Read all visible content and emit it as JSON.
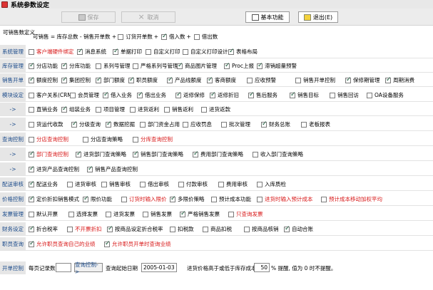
{
  "window": {
    "title": "系统参数设定"
  },
  "toolbar": {
    "save": "保存",
    "cancel": "取消",
    "basic": "基本功能",
    "exit": "退出(E)"
  },
  "avail_label": "可销售数定义",
  "formula": {
    "prefix": "可销售 = 库存总数 - 销售开单数 +",
    "items": [
      {
        "label": "订货开单数",
        "checked": false,
        "sign": "+"
      },
      {
        "label": "借入数",
        "checked": true,
        "sign": "+"
      },
      {
        "label": "借出数",
        "checked": false,
        "sign": ""
      }
    ]
  },
  "rows": [
    {
      "label": "系统管理",
      "items": [
        {
          "t": "客户端硬件绑定",
          "c": false,
          "r": true
        },
        {
          "t": "消息系统",
          "c": true
        },
        {
          "t": "单据打印",
          "c": true
        },
        {
          "t": "自定义打印",
          "c": false
        },
        {
          "t": "自定义打印设计",
          "c": false
        },
        {
          "t": "表格布局",
          "c": true
        }
      ]
    },
    {
      "label": "库存管理",
      "items": [
        {
          "t": "分店功能",
          "c": true
        },
        {
          "t": "分库功能",
          "c": true
        },
        {
          "t": "系列号管理",
          "c": false
        },
        {
          "t": "严格系列号管理",
          "c": false
        },
        {
          "t": "商品图片管理",
          "c": true
        },
        {
          "t": "Proc上报",
          "c": true
        },
        {
          "t": "滞销超量预警",
          "c": true
        }
      ]
    },
    {
      "label": "销售开单",
      "items": [
        {
          "t": "额度控制",
          "c": true
        },
        {
          "t": "集团控制",
          "c": true
        },
        {
          "t": "部门额度",
          "c": true
        },
        {
          "t": "职员额度",
          "c": true
        },
        {
          "t": "产品线额度",
          "c": true
        },
        {
          "t": "客商额度",
          "c": true
        },
        {
          "t": "应收预警",
          "c": false
        },
        {
          "t": "销售开单控制",
          "c": false
        },
        {
          "t": "保修期管理",
          "c": true
        },
        {
          "t": "周期消费",
          "c": true
        }
      ]
    },
    {
      "label": "模块设定",
      "items": [
        {
          "t": "客户关系(CRM)",
          "c": false
        },
        {
          "t": "会员管理",
          "c": false
        },
        {
          "t": "借入业务",
          "c": true
        },
        {
          "t": "借出业务",
          "c": true
        },
        {
          "t": "返修保修",
          "c": true
        },
        {
          "t": "返修折旧",
          "c": true
        },
        {
          "t": "售后服务",
          "c": true
        },
        {
          "t": "销售目标",
          "c": true
        },
        {
          "t": "销售回访",
          "c": false
        },
        {
          "t": "OA设备服务",
          "c": false
        }
      ]
    },
    {
      "label": "->",
      "items": [
        {
          "t": "直销业务",
          "c": false
        },
        {
          "t": "组装业务",
          "c": true
        },
        {
          "t": "项目管理",
          "c": false
        },
        {
          "t": "进货返利",
          "c": false
        },
        {
          "t": "销售返利",
          "c": false
        },
        {
          "t": "进货返款",
          "c": false
        }
      ]
    },
    {
      "label": "->",
      "items": [
        {
          "t": "货运代收款",
          "c": false
        },
        {
          "t": "分级查询",
          "c": true
        },
        {
          "t": "数据挖掘",
          "c": true
        },
        {
          "t": "部门资金占用",
          "c": false
        },
        {
          "t": "应收罚息",
          "c": false
        },
        {
          "t": "批次管理",
          "c": false
        },
        {
          "t": "财务总账",
          "c": true
        },
        {
          "t": "老板报表",
          "c": false
        }
      ]
    },
    {
      "label": "查询控制",
      "items": [
        {
          "t": "分店查询控制",
          "c": false,
          "r": true
        },
        {
          "t": "分店查询策略",
          "c": false
        },
        {
          "t": "分库查询控制",
          "c": false,
          "r": true
        }
      ]
    },
    {
      "label": "->",
      "items": [
        {
          "t": "部门查询控制",
          "c": true,
          "r": true
        },
        {
          "t": "进货部门查询策略",
          "c": true
        },
        {
          "t": "销售部门查询策略",
          "c": true
        },
        {
          "t": "费用部门查询策略",
          "c": true
        },
        {
          "t": "收入部门查询策略",
          "c": false
        }
      ]
    },
    {
      "label": "->",
      "items": [
        {
          "t": "进货产品查询控制",
          "c": true
        },
        {
          "t": "销售产品查询控制",
          "c": true
        }
      ]
    },
    {
      "label": "配送审核",
      "items": [
        {
          "t": "配送业务",
          "c": true
        },
        {
          "t": "进货审核",
          "c": false
        },
        {
          "t": "销售审核",
          "c": false
        },
        {
          "t": "借出审核",
          "c": false
        },
        {
          "t": "付款审核",
          "c": false
        },
        {
          "t": "费用审核",
          "c": false
        },
        {
          "t": "入库质检",
          "c": false
        }
      ]
    },
    {
      "label": "价格控制",
      "items": [
        {
          "t": "定价折扣销售模式",
          "c": true
        },
        {
          "t": "限价功能",
          "c": true
        },
        {
          "t": "订货时输入限价",
          "c": false,
          "r": true
        },
        {
          "t": "多限价策略",
          "c": true
        },
        {
          "t": "预计成本功能",
          "c": false
        },
        {
          "t": "进货时输入预计成本",
          "c": false,
          "r": true
        },
        {
          "t": "预计成本移动加权平均",
          "c": false,
          "r": true
        }
      ]
    },
    {
      "label": "发票管理",
      "items": [
        {
          "t": "默认开票",
          "c": false
        },
        {
          "t": "选择发票",
          "c": false
        },
        {
          "t": "进货发票",
          "c": false
        },
        {
          "t": "销售发票",
          "c": false
        },
        {
          "t": "严格销售发票",
          "c": true
        },
        {
          "t": "只查询发票",
          "c": false,
          "r": true
        }
      ]
    },
    {
      "label": "财务设定",
      "items": [
        {
          "t": "折合税率",
          "c": true
        },
        {
          "t": "不开票折扣",
          "c": false,
          "r": true
        },
        {
          "t": "按商品设定折合税率",
          "c": true
        },
        {
          "t": "扣税款",
          "c": false
        },
        {
          "t": "商品扣税",
          "c": false
        },
        {
          "t": "按商品核销",
          "c": false
        },
        {
          "t": "自动合账",
          "c": true
        }
      ]
    },
    {
      "label": "职员查询",
      "items": [
        {
          "t": "允许职员查询自己的业绩",
          "c": true,
          "r": true
        },
        {
          "t": "允许职员开单时查询业绩",
          "c": true,
          "r": true
        }
      ]
    }
  ],
  "bottom": {
    "label": "开单控制",
    "page_records_label": "每页记录数",
    "page_records_value": "",
    "query_btn": "查询控制->",
    "query_date_label": "查询起始日期",
    "query_date_value": "2005-01-03",
    "cost_hint": "进货价格高于或低于库存成本",
    "cost_pct": "50",
    "cost_suffix": "% 提醒, 值为 0 时不提醒。"
  }
}
